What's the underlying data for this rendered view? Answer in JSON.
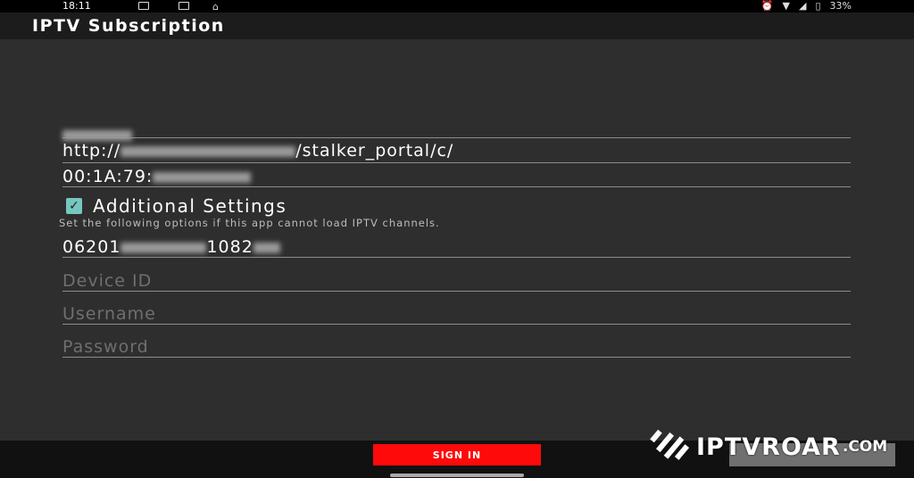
{
  "status_bar": {
    "time": "18:11",
    "battery": "33%"
  },
  "app": {
    "title": "IPTV Subscription"
  },
  "form": {
    "server_url_prefix": "http://",
    "server_url_suffix": "/stalker_portal/c/",
    "mac_prefix": "00:1A:79:",
    "additional_settings_label": "Additional Settings",
    "additional_settings_checked": true,
    "hint": "Set the following options if this app cannot load IPTV channels.",
    "serial_prefix": "06201",
    "serial_suffix": "1082",
    "device_id_placeholder": "Device ID",
    "username_placeholder": "Username",
    "password_placeholder": "Password"
  },
  "buttons": {
    "sign_in": "SIGN IN"
  },
  "watermark": {
    "name": "IPTVROAR",
    "suffix": ".COM"
  },
  "colors": {
    "accent_checkbox": "#76c7c0",
    "sign_in_button": "#ff0a0a"
  }
}
